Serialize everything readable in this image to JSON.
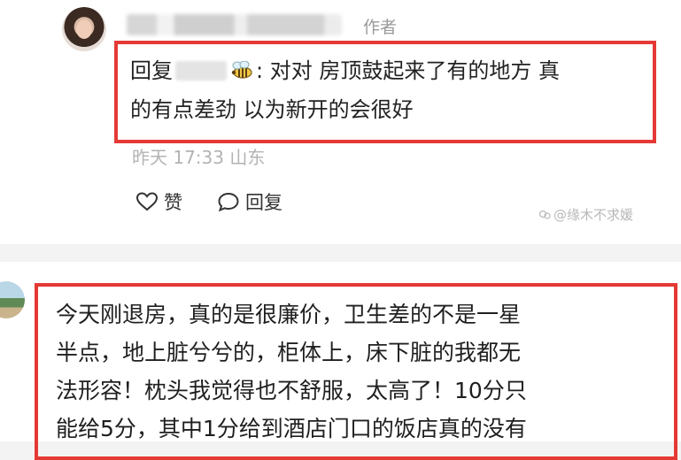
{
  "comment": {
    "author_tag": "作者",
    "reply_prefix": "回复",
    "reply_body_line1": ": 对对 房顶鼓起来了有的地方 真",
    "reply_body_line2": "的有点差劲 以为新开的会很好",
    "meta": "昨天 17:33 山东",
    "like_label": "赞",
    "reply_label": "回复"
  },
  "watermark": "@缘木不求媛",
  "review": {
    "lines": [
      "今天刚退房，真的是很廉价，卫生差的不是一星",
      "半点，地上脏兮兮的，柜体上，床下脏的我都无",
      "法形容！枕头我觉得也不舒服，太高了！10分只",
      "能给5分，其中1分给到酒店门口的饭店真的没有"
    ]
  },
  "colors": {
    "highlight_border": "#e53935",
    "meta_text": "#b3b3b3"
  }
}
